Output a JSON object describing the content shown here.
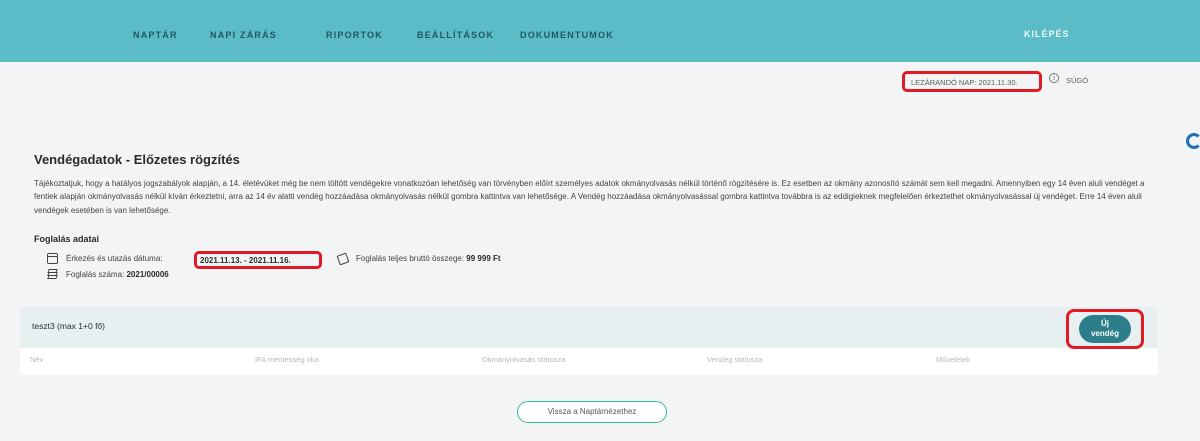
{
  "nav": {
    "items": [
      "NAPTÁR",
      "NAPI ZÁRÁS",
      "RIPORTOK",
      "BEÁLLÍTÁSOK",
      "DOKUMENTUMOK"
    ],
    "logout": "KILÉPÉS"
  },
  "status": {
    "close_day": "LEZÁRANDÓ NAP: 2021.11.30.",
    "help": "SÚGÓ"
  },
  "page": {
    "title": "Vendégadatok - Előzetes rögzítés",
    "info": "Tájékoztatjuk, hogy a hatályos jogszabályok alapján, a 14. életévüket még be nem töltött vendégekre vonatkozóan lehetőség van törvényben előírt személyes adatok okmányolvasás nélkül történő rögzítésére is. Ez esetben az okmány azonosító számát sem kell megadni. Amennyiben egy 14 éven aluli vendéget a fentiek alapján okmányolvasás nélkül kíván érkeztetni, arra az 14 év alatti vendég hozzáadása okmányolvasás nélkül gombra kattintva van lehetősége. A Vendég hozzáadása okmányolvasással gombra kattintva továbbra is az eddigieknek megfelelően érkeztethet okmányolvasással új vendéget. Erre 14 éven aluli vendégek esetében is van lehetősége."
  },
  "booking": {
    "section_title": "Foglalás adatai",
    "dates_label": "Érkezés és utazás dátuma:",
    "dates_value": "2021.11.13. - 2021.11.16.",
    "total_label": "Foglalás teljes bruttó összege:",
    "total_value": "99 999 Ft",
    "number_label": "Foglalás száma:",
    "number_value": "2021/00006"
  },
  "guests": {
    "room": "teszt3 (max 1+0 fő)",
    "new_guest_line1": "Új",
    "new_guest_line2": "vendég",
    "columns": [
      "Név",
      "IFA mentesség oka",
      "Okmányolvasás státusza",
      "Vendég státusza",
      "Műveletek"
    ]
  },
  "footer": {
    "back_label": "Vissza a Naptárnézethez"
  },
  "colors": {
    "nav_bg": "#5bbcc7",
    "accent": "#2b7e8a",
    "highlight": "#e01b24"
  }
}
